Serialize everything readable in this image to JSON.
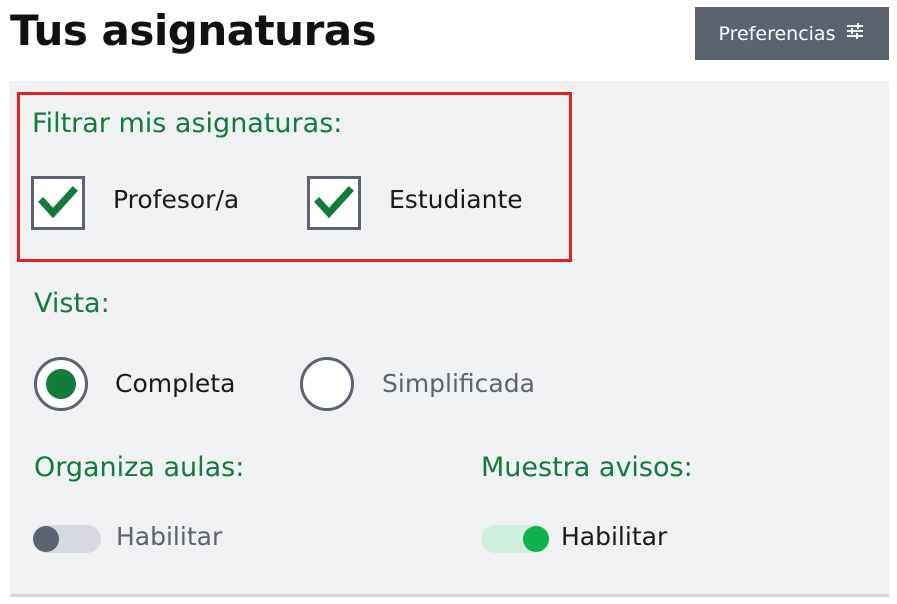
{
  "header": {
    "title": "Tus asignaturas",
    "preferences_label": "Preferencias",
    "preferences_icon": "sliders-icon"
  },
  "filter": {
    "label": "Filtrar mis asignaturas:",
    "options": [
      {
        "label": "Profesor/a",
        "checked": true
      },
      {
        "label": "Estudiante",
        "checked": true
      }
    ]
  },
  "view": {
    "label": "Vista:",
    "options": [
      {
        "label": "Completa",
        "selected": true
      },
      {
        "label": "Simplificada",
        "selected": false
      }
    ]
  },
  "organize": {
    "label": "Organiza aulas:",
    "toggle_label": "Habilitar",
    "enabled": false
  },
  "notices": {
    "label": "Muestra avisos:",
    "toggle_label": "Habilitar",
    "enabled": true
  },
  "colors": {
    "accent_green": "#127a3a",
    "toggle_on": "#10b04e",
    "highlight_red": "#e31f26",
    "button_bg": "#5b6270"
  }
}
